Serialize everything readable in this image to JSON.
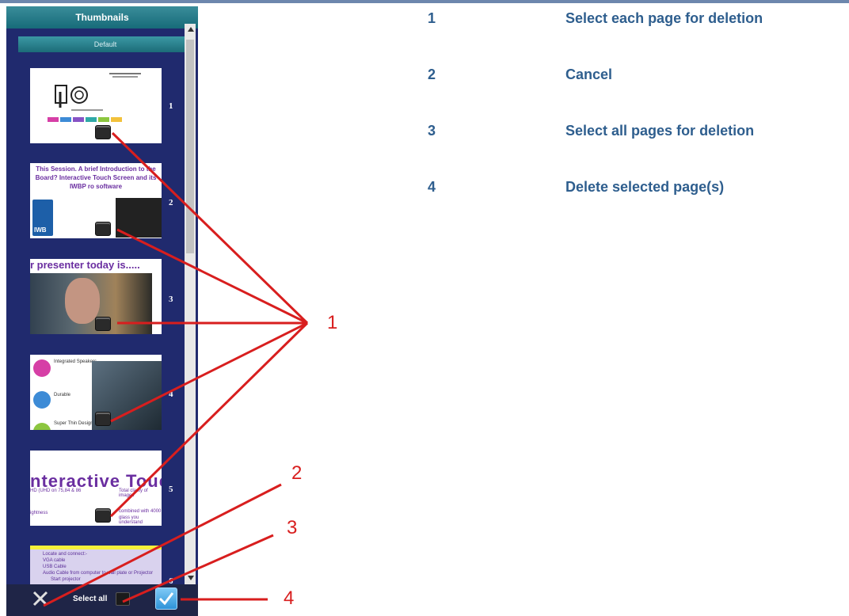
{
  "panel": {
    "title": "Thumbnails",
    "default_button": "Default",
    "pages": [
      {
        "number": "1",
        "title": "",
        "body": ""
      },
      {
        "number": "2",
        "title": "This Session. A brief Introduction to the Board? Interactive Touch Screen and its IWBP ro software",
        "badge": "IWB"
      },
      {
        "number": "3",
        "title": "r presenter today is....."
      },
      {
        "number": "4",
        "items": [
          "Integrated Speakers",
          "Durable",
          "Super Thin Design"
        ]
      },
      {
        "number": "5",
        "title": "nteractive Touc",
        "lines": [
          "HD (UHD on 75,84 & 86",
          "ightness",
          "Total clarity of images",
          "combined with 4000",
          "glass you understand"
        ]
      },
      {
        "number": "6",
        "lines": [
          "Locate and connect:-",
          "VGA cable",
          "USB Cable",
          "Audio Cable from computer to wall plate or Projector",
          "Start projector"
        ]
      }
    ],
    "select_all_label": "Select all"
  },
  "legend": [
    {
      "num": "1",
      "label": "Select each page for deletion"
    },
    {
      "num": "2",
      "label": "Cancel"
    },
    {
      "num": "3",
      "label": "Select all pages for deletion"
    },
    {
      "num": "4",
      "label": "Delete selected page(s)"
    }
  ],
  "callouts": [
    "1",
    "2",
    "3",
    "4"
  ],
  "colors": {
    "panel_bg": "#202a6e",
    "annotation_red": "#d81e1e",
    "legend_text": "#2e5e8e"
  }
}
